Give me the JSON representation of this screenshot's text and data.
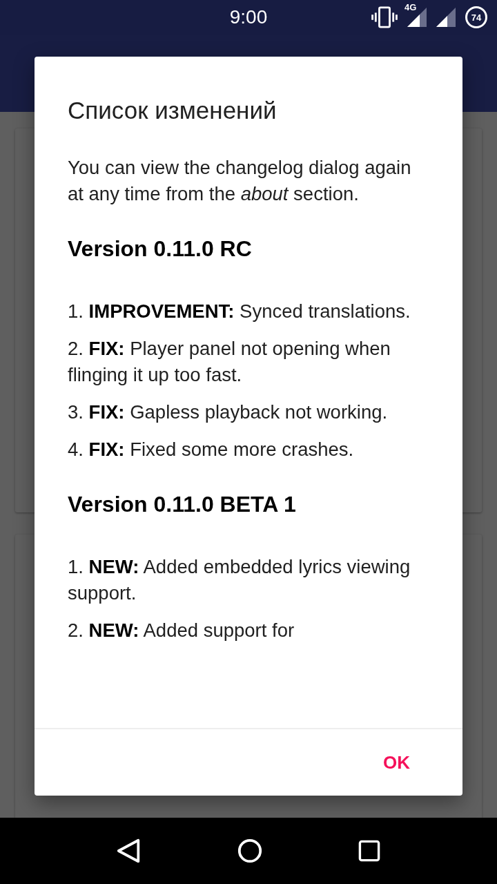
{
  "status_bar": {
    "time": "9:00",
    "network": "4G",
    "battery": "74"
  },
  "dialog": {
    "title": "Список изменений",
    "intro": "You can view the changelog dialog again at any time from the *about* section.",
    "versions": [
      {
        "title": "Version 0.11.0 RC",
        "items": [
          "1. **IMPROVEMENT:** Synced translations.",
          "2. **FIX:** Player panel not opening when flinging it up too fast.",
          "3. **FIX:** Gapless playback not working.",
          "4. **FIX:** Fixed some more crashes."
        ]
      },
      {
        "title": "Version 0.11.0 BETA 1",
        "items": [
          "1. **NEW:** Added embedded lyrics viewing support.",
          "2. **NEW:** Added support for"
        ]
      }
    ],
    "button": "OK"
  }
}
